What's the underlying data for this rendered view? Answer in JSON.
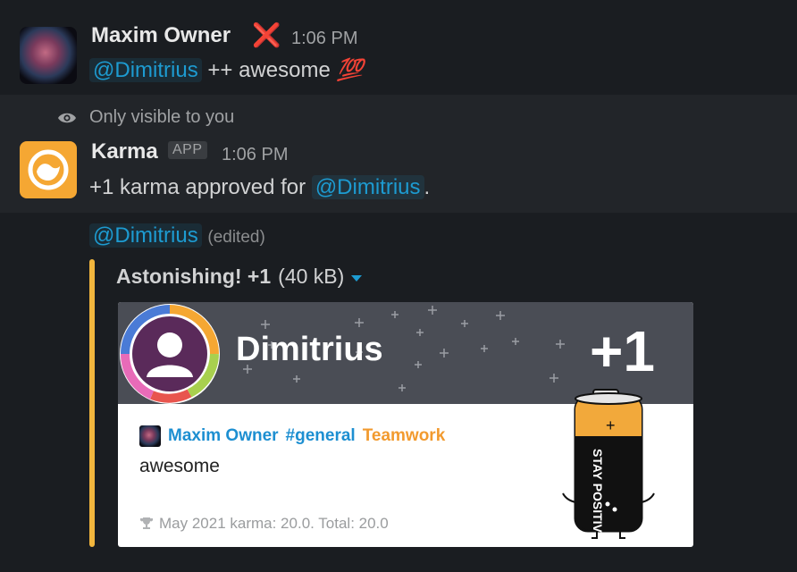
{
  "message1": {
    "author": "Maxim Owner",
    "status_emoji": "❌",
    "time": "1:06 PM",
    "mention": "@Dimitrius",
    "text_after_mention": " ++ awesome ",
    "reaction_emoji": "💯"
  },
  "ephemeral": {
    "notice": "Only visible to you"
  },
  "message2": {
    "author": "Karma",
    "badge": "APP",
    "time": "1:06 PM",
    "text_before": "+1 karma approved for ",
    "mention": "@Dimitrius",
    "text_after": "."
  },
  "message3": {
    "mention": "@Dimitrius",
    "edited": "(edited)",
    "attachment": {
      "title": "Astonishing! +1",
      "size": "(40 kB)",
      "card": {
        "name": "Dimitrius",
        "plus": "+1",
        "from_user": "Maxim Owner",
        "channel": "#general",
        "category": "Teamwork",
        "text": "awesome",
        "footer": "May 2021 karma: 20.0. Total: 20.0",
        "battery_text": "STAY POSITIVE"
      }
    }
  },
  "colors": {
    "background": "#1a1d21",
    "mention": "#1d9bd1",
    "attachment_bar": "#f2b63d",
    "karma_avatar": "#f5a733"
  }
}
